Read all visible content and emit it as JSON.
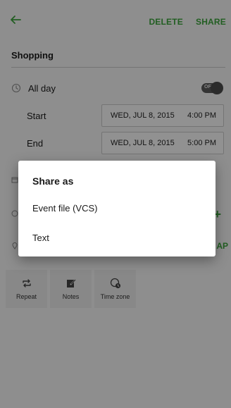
{
  "header": {
    "delete_label": "DELETE",
    "share_label": "SHARE"
  },
  "event": {
    "title": "Shopping"
  },
  "all_day": {
    "label": "All day",
    "toggle_text": "OFF"
  },
  "start": {
    "label": "Start",
    "date": "WED, JUL 8, 2015",
    "time": "4:00 PM"
  },
  "end": {
    "label": "End",
    "date": "WED, JUL 8, 2015",
    "time": "5:00 PM"
  },
  "partial": {
    "map_text": "AP"
  },
  "quick_actions": [
    {
      "label": "Repeat",
      "icon": "repeat-icon"
    },
    {
      "label": "Notes",
      "icon": "notes-icon"
    },
    {
      "label": "Time zone",
      "icon": "time-zone-icon"
    }
  ],
  "dialog": {
    "title": "Share as",
    "options": [
      "Event file (VCS)",
      "Text"
    ]
  },
  "colors": {
    "accent": "#3ba33b"
  }
}
